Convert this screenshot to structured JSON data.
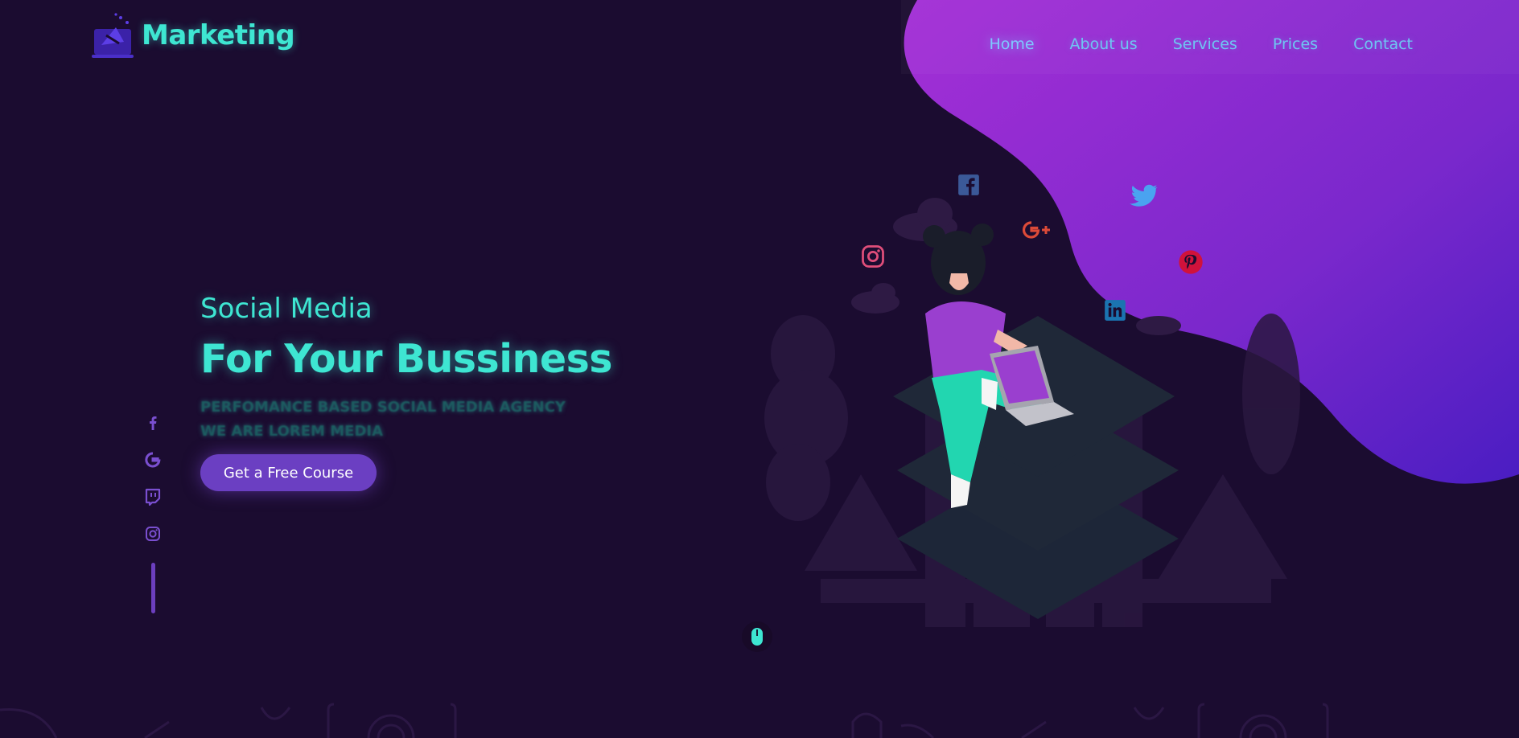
{
  "brand": {
    "name": "Marketing",
    "icon": "megaphone-icon"
  },
  "nav": {
    "items": [
      {
        "label": "Home",
        "active": true
      },
      {
        "label": "About us",
        "active": false
      },
      {
        "label": "Services",
        "active": false
      },
      {
        "label": "Prices",
        "active": false
      },
      {
        "label": "Contact",
        "active": false
      }
    ]
  },
  "hero": {
    "subtitle": "Social Media",
    "title": "For Your Bussiness",
    "tagline_line1": "PERFOMANCE BASED SOCIAL MEDIA AGENCY",
    "tagline_line2": "WE ARE LOREM MEDIA",
    "cta_label": "Get a Free Course"
  },
  "side_social": [
    "facebook-icon",
    "google-icon",
    "twitch-icon",
    "instagram-icon"
  ],
  "floating_icons": [
    "facebook-icon",
    "google-plus-icon",
    "twitter-icon",
    "instagram-icon",
    "pinterest-icon",
    "linkedin-icon"
  ],
  "colors": {
    "background": "#1b0c30",
    "accent": "#3ee6d2",
    "nav_link": "#6ec6f2",
    "button": "#6b3fc2",
    "blob_start": "#a42fd6",
    "blob_end": "#5521c4"
  }
}
